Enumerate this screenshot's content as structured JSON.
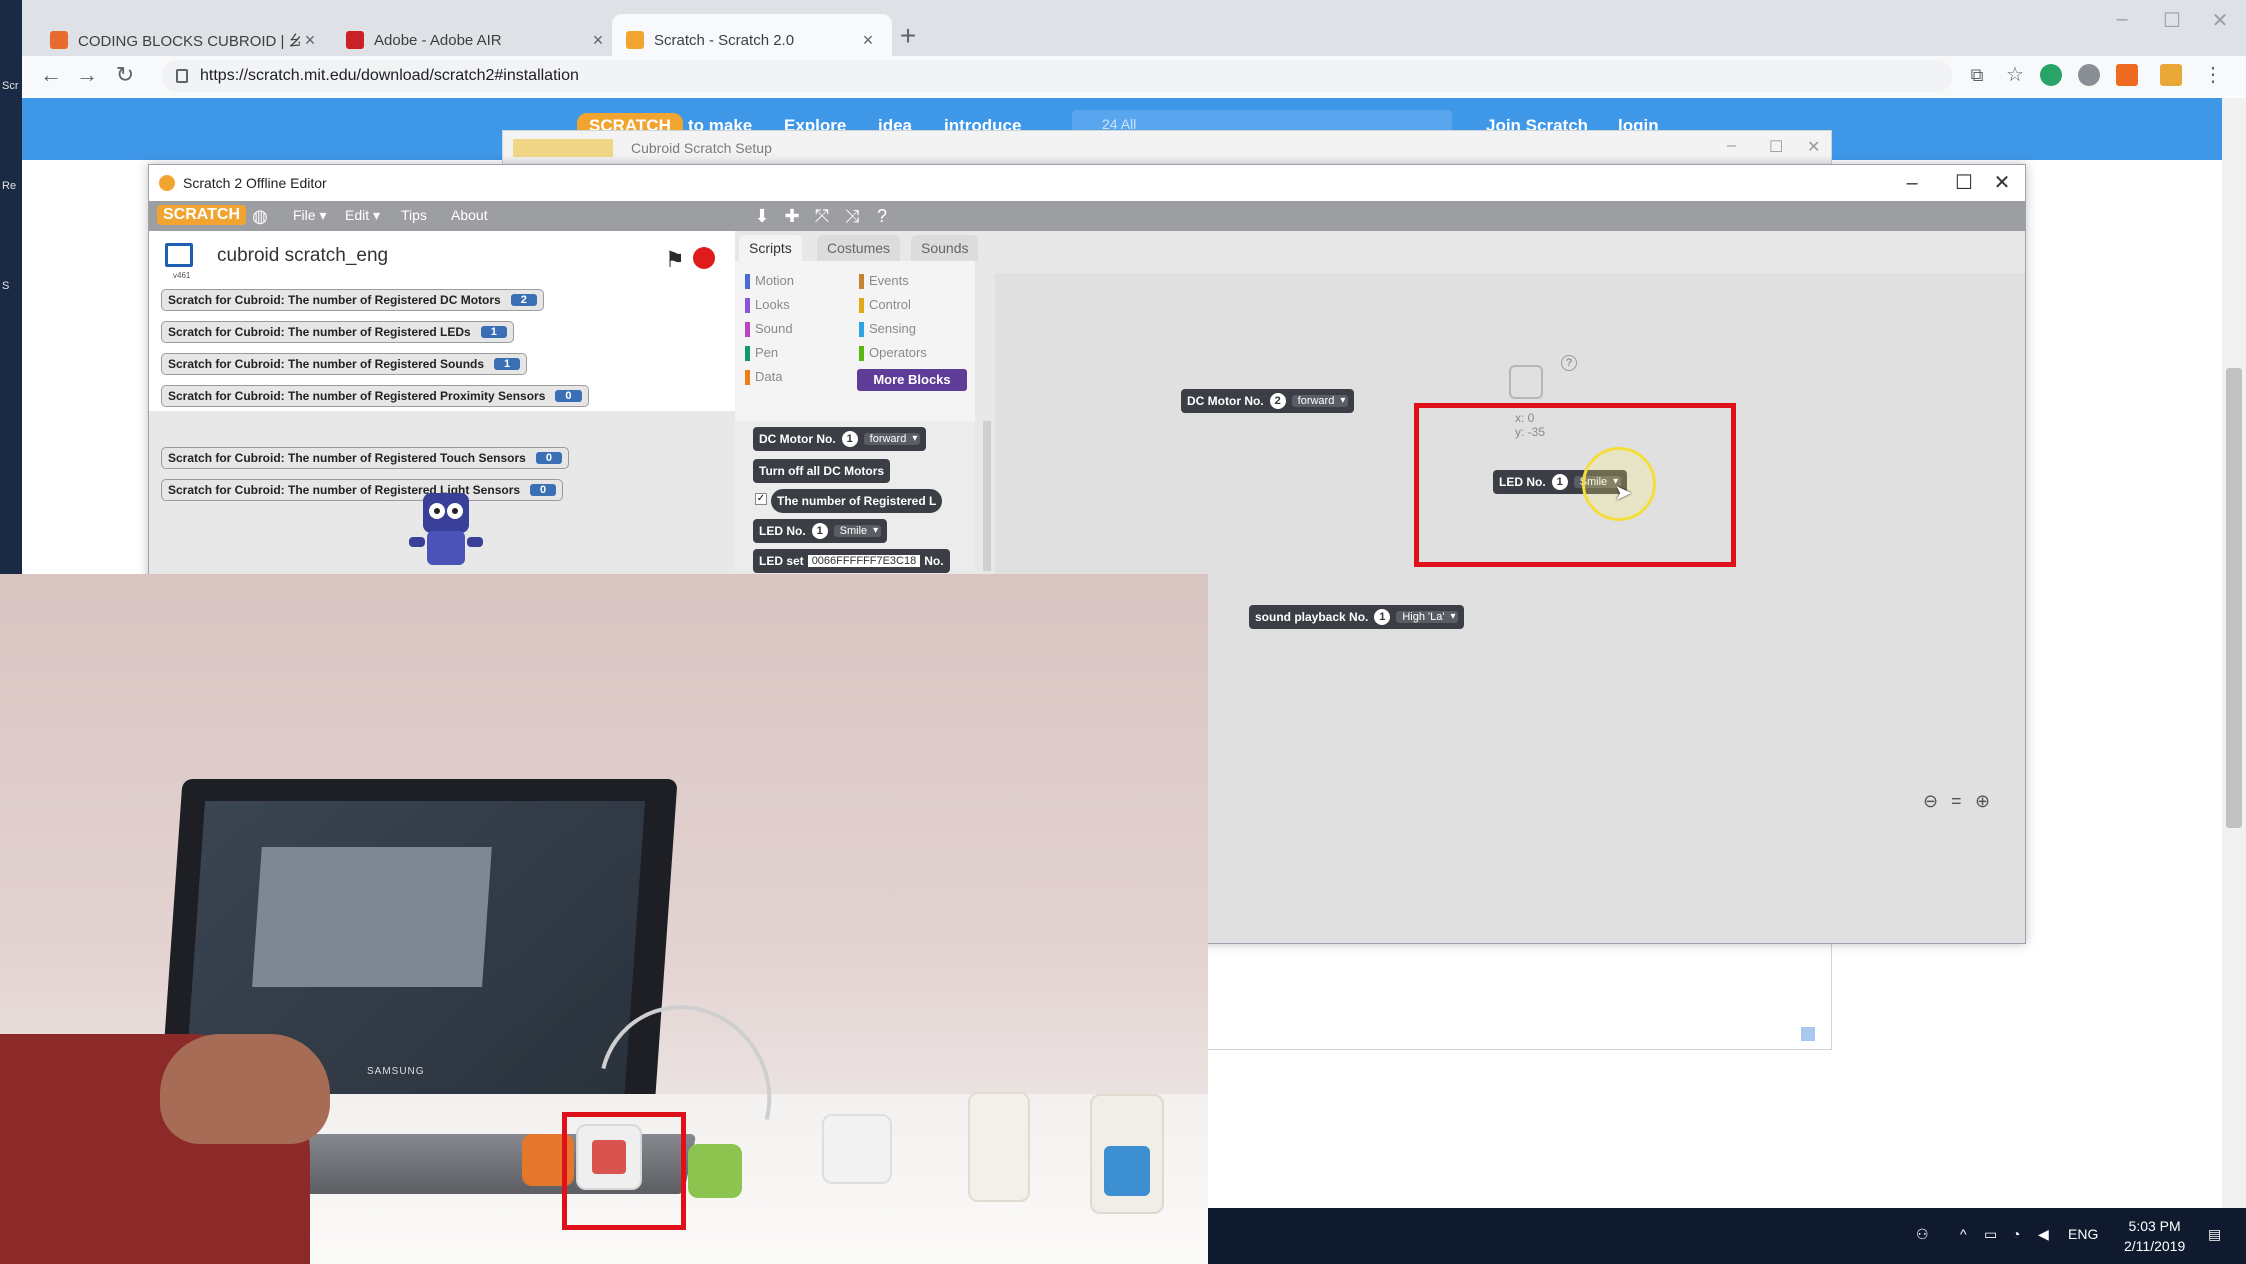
{
  "browser": {
    "tabs": [
      {
        "label": "CODING BLOCKS CUBROID | 幺",
        "active": false
      },
      {
        "label": "Adobe - Adobe AIR",
        "active": false
      },
      {
        "label": "Scratch - Scratch 2.0",
        "active": true
      }
    ],
    "url": "https://scratch.mit.edu/download/scratch2#installation"
  },
  "site": {
    "logo": "SCRATCH",
    "nav": [
      "to make",
      "Explore",
      "idea",
      "introduce"
    ],
    "search_placeholder": "24 All",
    "join": "Join Scratch",
    "login": "login"
  },
  "setup_window": {
    "title": "Cubroid Scratch Setup"
  },
  "editor": {
    "title": "Scratch 2 Offline Editor",
    "logo": "SCRATCH",
    "menu": [
      "File ▾",
      "Edit ▾",
      "Tips",
      "About"
    ],
    "project_name": "cubroid scratch_eng",
    "project_version": "v461",
    "monitors": [
      {
        "label": "Scratch for Cubroid: The number of Registered DC Motors",
        "value": "2"
      },
      {
        "label": "Scratch for Cubroid: The number of Registered LEDs",
        "value": "1"
      },
      {
        "label": "Scratch for Cubroid: The number of Registered Sounds",
        "value": "1"
      },
      {
        "label": "Scratch for Cubroid: The number of Registered Proximity Sensors",
        "value": "0"
      },
      {
        "label": "Scratch for Cubroid: The number of Registered Touch Sensors",
        "value": "0"
      },
      {
        "label": "Scratch for Cubroid: The number of Registered Light Sensors",
        "value": "0"
      }
    ],
    "tabs": [
      "Scripts",
      "Costumes",
      "Sounds"
    ],
    "categories_left": [
      {
        "label": "Motion",
        "color": "#4a6cd4"
      },
      {
        "label": "Looks",
        "color": "#8a55d7"
      },
      {
        "label": "Sound",
        "color": "#bb42c3"
      },
      {
        "label": "Pen",
        "color": "#0e9a6c"
      },
      {
        "label": "Data",
        "color": "#ee7d16"
      }
    ],
    "categories_right": [
      {
        "label": "Events",
        "color": "#c88330"
      },
      {
        "label": "Control",
        "color": "#e1a91a"
      },
      {
        "label": "Sensing",
        "color": "#2ca5e2"
      },
      {
        "label": "Operators",
        "color": "#5cb712"
      }
    ],
    "more_blocks": "More Blocks",
    "palette_blocks": {
      "dc_motor": {
        "prefix": "DC Motor No.",
        "num": "1",
        "dir": "forward"
      },
      "turn_off": "Turn off all DC Motors",
      "registered": "The number of Registered L",
      "led": {
        "prefix": "LED No.",
        "num": "1",
        "mode": "Smile"
      },
      "led_set": {
        "prefix": "LED set",
        "value": "0066FFFFFF7E3C18",
        "suffix": "No."
      }
    },
    "script_blocks": {
      "dc_motor": {
        "prefix": "DC Motor No.",
        "num": "2",
        "dir": "forward"
      },
      "led": {
        "prefix": "LED No.",
        "num": "1",
        "mode": "Smile"
      },
      "sound": {
        "prefix": "sound playback No.",
        "num": "1",
        "note": "High 'La'"
      }
    },
    "xy": {
      "x": "x: 0",
      "y": "y: -35"
    },
    "zoom": [
      "🔍−",
      "=",
      "🔍+"
    ]
  },
  "photo": {
    "laptop_brand": "SAMSUNG"
  },
  "taskbar": {
    "lang": "ENG",
    "time": "5:03 PM",
    "date": "2/11/2019"
  },
  "desktop": {
    "icons": [
      "Scr",
      "Re",
      "S"
    ]
  },
  "colors": {
    "highlight": "#e0101a",
    "scratch_blue": "#3f97e8",
    "block_dark": "#3b3f45"
  }
}
